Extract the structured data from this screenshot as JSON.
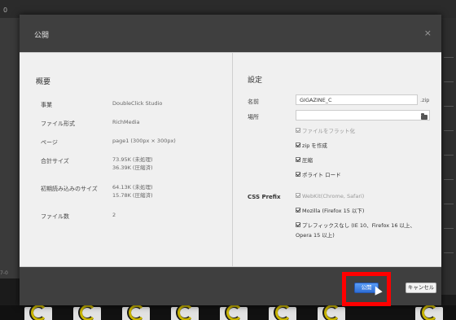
{
  "background": {
    "top_tab": "0",
    "left_label": "7-0"
  },
  "dialog": {
    "title": "公開",
    "close": "×",
    "summary": {
      "title": "概要",
      "rows": [
        {
          "label": "事業",
          "value": "DoubleClick Studio"
        },
        {
          "label": "ファイル形式",
          "value": "RichMedia"
        },
        {
          "label": "ページ",
          "value": "page1 (300px × 300px)"
        },
        {
          "label": "合計サイズ",
          "value": "73.95K (未処理)",
          "value2": "36.39K (圧縮済)"
        },
        {
          "label": "初期読み込みのサイズ",
          "value": "64.13K (未処理)",
          "value2": "15.78K (圧縮済)"
        },
        {
          "label": "ファイル数",
          "value": "2"
        }
      ]
    },
    "settings": {
      "title": "設定",
      "name_label": "名前",
      "name_value": "GIGAZINE_C",
      "name_suffix": ".zip",
      "location_label": "場所",
      "location_value": "",
      "checks": [
        {
          "label": "ファイルをフラット化",
          "checked": true,
          "disabled": true
        },
        {
          "label": "zip を作成",
          "checked": true,
          "disabled": false
        },
        {
          "label": "圧縮",
          "checked": true,
          "disabled": false
        },
        {
          "label": "ポライト ロード",
          "checked": true,
          "disabled": false
        }
      ],
      "css_prefix_label": "CSS Prefix",
      "css_checks": [
        {
          "label": "WebKit(Chrome, Safari)",
          "checked": true,
          "disabled": true
        },
        {
          "label": "Mozilla (Firefox 15 以下)",
          "checked": true,
          "disabled": false
        },
        {
          "label": "プレフィックスなし (IE 10、Firefox 16 以上、",
          "label2": "Opera 15 以上)",
          "checked": true,
          "disabled": false
        }
      ]
    },
    "buttons": {
      "publish": "公開",
      "cancel": "キャンセル"
    }
  }
}
